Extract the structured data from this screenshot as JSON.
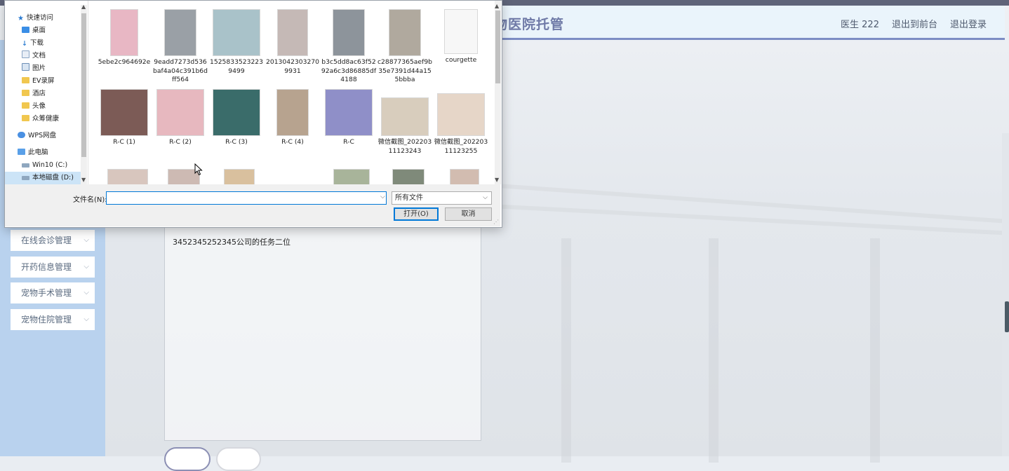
{
  "app": {
    "title": "宠物医院托管",
    "user": "医生 222",
    "nav": [
      "退出到前台",
      "退出登录"
    ]
  },
  "sidebar": {
    "items": [
      {
        "label": "在线会诊管理"
      },
      {
        "label": "开药信息管理"
      },
      {
        "label": "宠物手术管理"
      },
      {
        "label": "宠物住院管理"
      }
    ]
  },
  "editor": {
    "content": "3452345252345公司的任务二位"
  },
  "dialog": {
    "nav": [
      {
        "label": "快速访问",
        "icon": "star-icon",
        "pinned": false
      },
      {
        "label": "桌面",
        "icon": "desktop-icon",
        "pinned": true
      },
      {
        "label": "下载",
        "icon": "download-icon",
        "pinned": true
      },
      {
        "label": "文档",
        "icon": "document-icon",
        "pinned": true
      },
      {
        "label": "图片",
        "icon": "picture-icon",
        "pinned": true
      },
      {
        "label": "EV录屏",
        "icon": "folder-icon",
        "pinned": false
      },
      {
        "label": "酒店",
        "icon": "folder-icon",
        "pinned": false
      },
      {
        "label": "头像",
        "icon": "folder-icon",
        "pinned": false
      },
      {
        "label": "众筹健康",
        "icon": "folder-icon",
        "pinned": false
      },
      {
        "label": "WPS网盘",
        "icon": "cloud-icon",
        "pinned": false
      },
      {
        "label": "此电脑",
        "icon": "computer-icon",
        "pinned": false
      },
      {
        "label": "Win10 (C:)",
        "icon": "drive-icon",
        "pinned": false
      },
      {
        "label": "本地磁盘 (D:)",
        "icon": "drive-icon",
        "pinned": false
      }
    ],
    "files": [
      {
        "name": "5ebe2c964692e",
        "color": "#e8b7c4"
      },
      {
        "name": "9eadd7273d536baf4a04c391b6dff564",
        "color": "#9aa0a6"
      },
      {
        "name": "15258335232239499",
        "color": "#a9c2c9"
      },
      {
        "name": "20130423032709931",
        "color": "#c5b9b6"
      },
      {
        "name": "b3c5dd8ac63f5292a6c3d86885df4188",
        "color": "#8d949b"
      },
      {
        "name": "c28877365aef9b35e7391d44a155bbba",
        "color": "#b0a99e"
      },
      {
        "name": "courgette",
        "color": "#f4f4f4"
      },
      {
        "name": "R-C (1)",
        "color": "#7c5b56"
      },
      {
        "name": "R-C (2)",
        "color": "#e7b8bf"
      },
      {
        "name": "R-C (3)",
        "color": "#3a6c6a"
      },
      {
        "name": "R-C (4)",
        "color": "#b7a38f"
      },
      {
        "name": "R-C",
        "color": "#8f8fc8"
      },
      {
        "name": "微信截图_20220311123243",
        "color": "#d8cdbd"
      },
      {
        "name": "微信截图_20220311123255",
        "color": "#e6d6c8"
      }
    ],
    "filename_label": "文件名(N):",
    "filename_value": "",
    "filetype": "所有文件",
    "open_label": "打开(O)",
    "cancel_label": "取消"
  }
}
